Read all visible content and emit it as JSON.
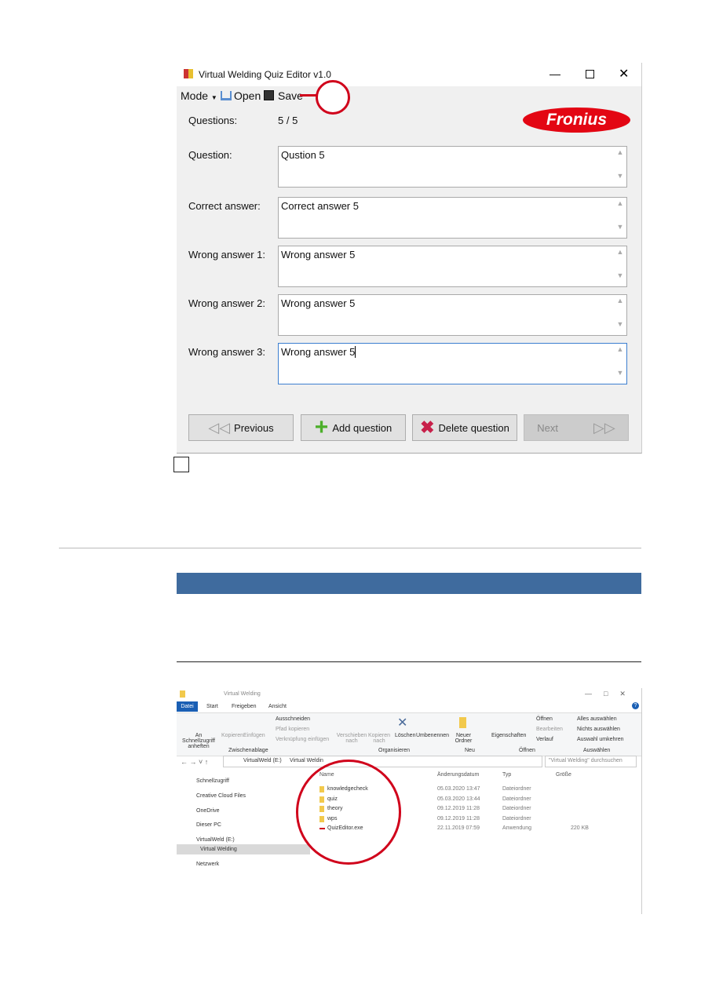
{
  "quiz_editor": {
    "title": "Virtual Welding Quiz Editor v1.0",
    "toolbar": {
      "mode": "Mode",
      "open": "Open",
      "save": "Save"
    },
    "questions_label": "Questions:",
    "questions_value": "5 / 5",
    "logo": "Fronius",
    "fields": [
      {
        "label": "Question:",
        "value": "Qustion 5"
      },
      {
        "label": "Correct answer:",
        "value": "Correct answer 5"
      },
      {
        "label": "Wrong answer 1:",
        "value": "Wrong answer 5"
      },
      {
        "label": "Wrong answer 2:",
        "value": "Wrong answer 5"
      },
      {
        "label": "Wrong answer 3:",
        "value": "Wrong answer 5"
      }
    ],
    "buttons": {
      "previous": "Previous",
      "add": "Add question",
      "delete": "Delete question",
      "next": "Next"
    },
    "highlight_color": "#d0021b"
  },
  "section_bar_color": "#3f6b9e",
  "explorer": {
    "title": "Virtual Welding",
    "tabs": [
      "Datei",
      "Start",
      "Freigeben",
      "Ansicht"
    ],
    "ribbon": {
      "pin": "An Schnellzugriff anheften",
      "copy": "Kopieren",
      "paste": "Einfügen",
      "cut": "Ausschneiden",
      "copy_path": "Pfad kopieren",
      "paste_link": "Verknüpfung einfügen",
      "group_clipboard": "Zwischenablage",
      "move": "Verschieben nach",
      "copy_to": "Kopieren nach",
      "delete": "Löschen",
      "rename": "Umbenennen",
      "group_organize": "Organisieren",
      "new_folder": "Neuer Ordner",
      "group_new": "Neu",
      "properties": "Eigenschaften",
      "open": "Öffnen",
      "edit": "Bearbeiten",
      "history": "Verlauf",
      "group_open": "Öffnen",
      "select_all": "Alles auswählen",
      "select_none": "Nichts auswählen",
      "invert": "Auswahl umkehren",
      "group_select": "Auswählen"
    },
    "address": [
      "VirtualWeld (E:)",
      "Virtual Weldin"
    ],
    "search_placeholder": "\"Virtual Welding\" durchsuchen",
    "nav": [
      "Schnellzugriff",
      "Creative Cloud Files",
      "OneDrive",
      "Dieser PC",
      "VirtualWeld (E:)",
      "Virtual Welding",
      "Netzwerk"
    ],
    "columns": [
      "Name",
      "Änderungsdatum",
      "Typ",
      "Größe"
    ],
    "files": [
      {
        "name": "knowledgecheck",
        "date": "05.03.2020 13:47",
        "type": "Dateiordner",
        "size": ""
      },
      {
        "name": "quiz",
        "date": "05.03.2020 13:44",
        "type": "Dateiordner",
        "size": ""
      },
      {
        "name": "theory",
        "date": "09.12.2019 11:28",
        "type": "Dateiordner",
        "size": ""
      },
      {
        "name": "wps",
        "date": "09.12.2019 11:28",
        "type": "Dateiordner",
        "size": ""
      },
      {
        "name": "QuizEditor.exe",
        "date": "22.11.2019 07:59",
        "type": "Anwendung",
        "size": "220 KB"
      }
    ]
  }
}
